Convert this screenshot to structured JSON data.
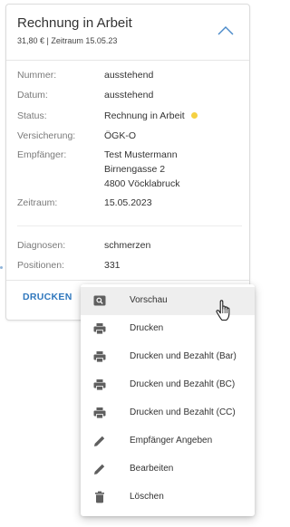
{
  "card": {
    "title": "Rechnung in Arbeit",
    "subtitle": "31,80 € | Zeitraum 15.05.23",
    "fields": {
      "nummer": {
        "label": "Nummer:",
        "value": "ausstehend"
      },
      "datum": {
        "label": "Datum:",
        "value": "ausstehend"
      },
      "status": {
        "label": "Status:",
        "value": "Rechnung in Arbeit",
        "color": "#f5d142"
      },
      "versicherung": {
        "label": "Versicherung:",
        "value": "ÖGK-O"
      },
      "empfaenger": {
        "label": "Empfänger:",
        "lines": [
          "Test Mustermann",
          "Birnengasse 2",
          "4800 Vöcklabruck"
        ]
      },
      "zeitraum": {
        "label": "Zeitraum:",
        "value": "15.05.2023"
      },
      "diagnosen": {
        "label": "Diagnosen:",
        "value": "schmerzen"
      },
      "positionen": {
        "label": "Positionen:",
        "value": "331"
      }
    },
    "print_label": "DRUCKEN"
  },
  "menu": {
    "items": [
      {
        "label": "Vorschau",
        "icon": "preview-icon"
      },
      {
        "label": "Drucken",
        "icon": "printer-icon"
      },
      {
        "label": "Drucken und Bezahlt (Bar)",
        "icon": "printer-icon"
      },
      {
        "label": "Drucken und Bezahlt (BC)",
        "icon": "printer-icon"
      },
      {
        "label": "Drucken und Bezahlt (CC)",
        "icon": "printer-icon"
      },
      {
        "label": "Empfänger Angeben",
        "icon": "pencil-icon"
      },
      {
        "label": "Bearbeiten",
        "icon": "pencil-icon"
      },
      {
        "label": "Löschen",
        "icon": "trash-icon"
      }
    ]
  },
  "colors": {
    "accent": "#2f77bd",
    "icon": "#5f5f5f",
    "status_dot": "#f5d142",
    "hover": "#eeeeee"
  }
}
